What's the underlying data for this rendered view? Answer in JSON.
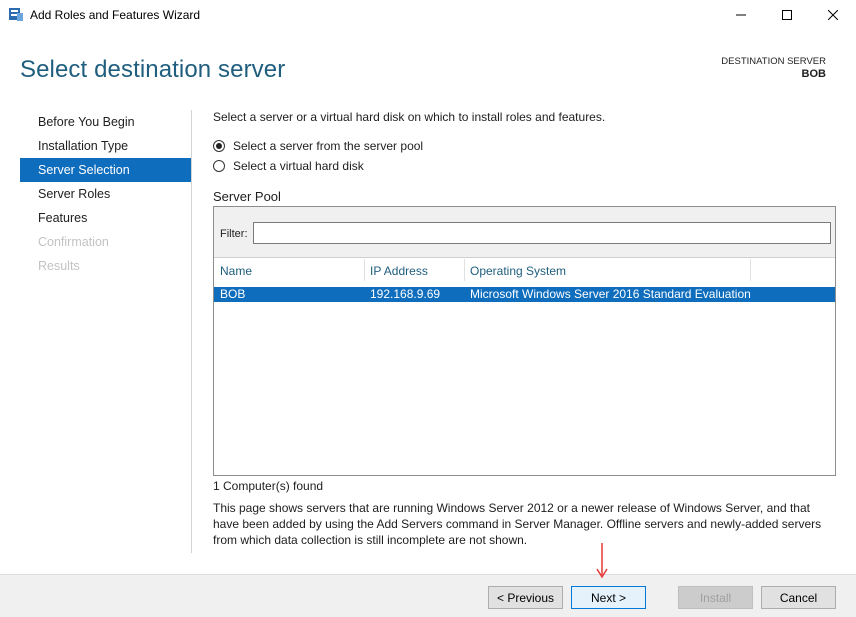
{
  "window": {
    "title": "Add Roles and Features Wizard",
    "controls": [
      "minimize-icon",
      "maximize-icon",
      "close-icon"
    ]
  },
  "header": {
    "page_title": "Select destination server",
    "destination_label": "DESTINATION SERVER",
    "destination_value": "BOB"
  },
  "sidebar": {
    "items": [
      {
        "label": "Before You Begin",
        "state": "normal"
      },
      {
        "label": "Installation Type",
        "state": "normal"
      },
      {
        "label": "Server Selection",
        "state": "active"
      },
      {
        "label": "Server Roles",
        "state": "normal"
      },
      {
        "label": "Features",
        "state": "normal"
      },
      {
        "label": "Confirmation",
        "state": "disabled"
      },
      {
        "label": "Results",
        "state": "disabled"
      }
    ]
  },
  "main": {
    "intro": "Select a server or a virtual hard disk on which to install roles and features.",
    "options": [
      {
        "label": "Select a server from the server pool",
        "selected": true
      },
      {
        "label": "Select a virtual hard disk",
        "selected": false
      }
    ],
    "pool_heading": "Server Pool",
    "filter_label": "Filter:",
    "filter_value": "",
    "columns": [
      "Name",
      "IP Address",
      "Operating System"
    ],
    "rows": [
      {
        "name": "BOB",
        "ip": "192.168.9.69",
        "os": "Microsoft Windows Server 2016 Standard Evaluation",
        "selected": true
      }
    ],
    "count": "1 Computer(s) found",
    "description": "This page shows servers that are running Windows Server 2012 or a newer release of Windows Server, and that have been added by using the Add Servers command in Server Manager. Offline servers and newly-added servers from which data collection is still incomplete are not shown."
  },
  "footer": {
    "previous": "< Previous",
    "next": "Next >",
    "install": "Install",
    "cancel": "Cancel"
  },
  "colors": {
    "accent": "#0f6dbd",
    "title": "#1f5e7e",
    "annotation_arrow": "#e53935"
  }
}
